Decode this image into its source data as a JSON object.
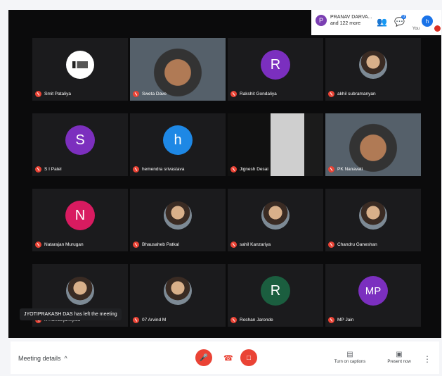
{
  "topbar": {
    "presenter_initial": "P",
    "presenter_name": "PRANAV DARVA...",
    "presenter_sub": "and 122 more",
    "participants_icon": "people-icon",
    "chat_icon": "chat-icon",
    "chat_badge": "0",
    "you_initial": "h",
    "you_label": "You",
    "colors": {
      "presenter": "#7b3fb2",
      "you": "#1a73e8"
    }
  },
  "tiles": [
    {
      "name": "Smit Pataliya",
      "kind": "logo"
    },
    {
      "name": "Sweta Dave",
      "kind": "video"
    },
    {
      "name": "Rakshit Gondaliya",
      "kind": "initial",
      "initial": "R",
      "color": "#7b2fbf"
    },
    {
      "name": "akhil subramanyan",
      "kind": "photo"
    },
    {
      "name": "S I Patel",
      "kind": "initial",
      "initial": "S",
      "color": "#7c2fbe"
    },
    {
      "name": "hemendra srivastava",
      "kind": "initial",
      "initial": "h",
      "color": "#1e88e5"
    },
    {
      "name": "Jignesh Desai",
      "kind": "video"
    },
    {
      "name": "PK Nanavati",
      "kind": "video"
    },
    {
      "name": "Natarajan Murugan",
      "kind": "initial",
      "initial": "N",
      "color": "#d81b60"
    },
    {
      "name": "Bhausaheb Patkal",
      "kind": "photo"
    },
    {
      "name": "sahil Kanzariya",
      "kind": "photo"
    },
    {
      "name": "Chandru Ganeshan",
      "kind": "photo"
    },
    {
      "name": "K Ramanjaneyulu",
      "kind": "photo"
    },
    {
      "name": "07 Arvind M",
      "kind": "photo"
    },
    {
      "name": "Roshan Jaronde",
      "kind": "initial",
      "initial": "R",
      "color": "#1b5e3f"
    },
    {
      "name": "MP Jain",
      "kind": "initial",
      "initial": "MP",
      "color": "#7b2fbf"
    }
  ],
  "toast": "JYOTIPRAKASH DAS has left the meeting",
  "bottom": {
    "meeting_details": "Meeting details",
    "captions": "Turn on captions",
    "present": "Present now"
  }
}
